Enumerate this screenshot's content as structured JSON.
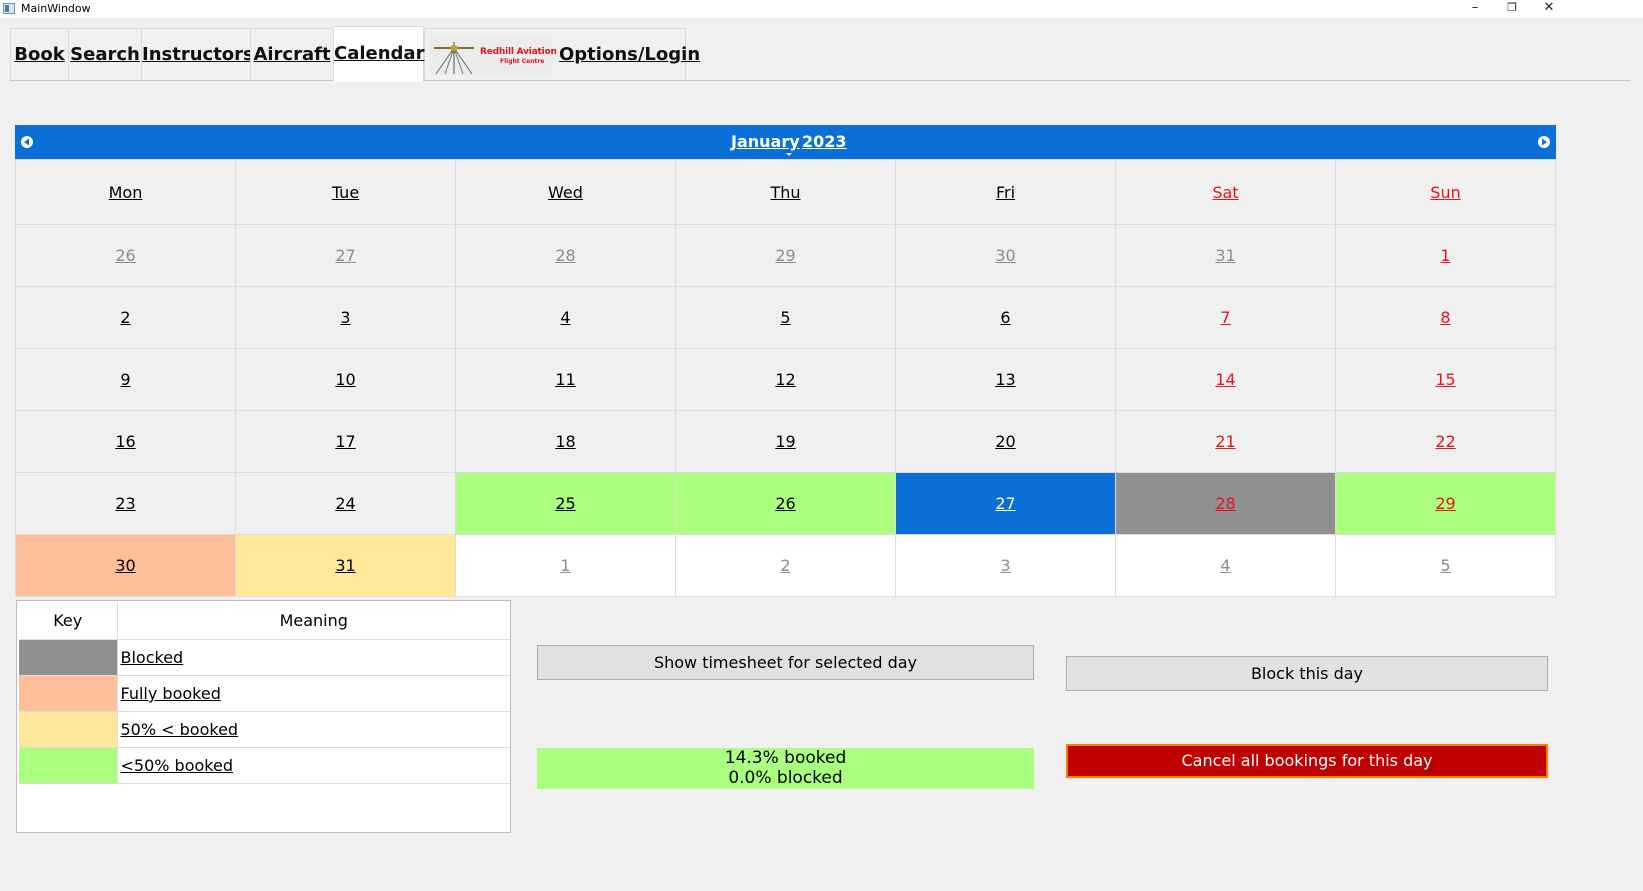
{
  "window": {
    "title": "MainWindow",
    "minimize": "–",
    "restore": "❐",
    "close": "✕"
  },
  "tabs": [
    {
      "label": "Book"
    },
    {
      "label": "Search"
    },
    {
      "label": "Instructors"
    },
    {
      "label": "Aircraft"
    },
    {
      "label": "Calendar"
    },
    {
      "label": "Options/Login"
    }
  ],
  "active_tab": "Calendar",
  "logo": {
    "line1": "Redhill Aviation",
    "line2": "Flight Centre"
  },
  "calendar": {
    "month": "January",
    "year": "2023",
    "weekdays": [
      "Mon",
      "Tue",
      "Wed",
      "Thu",
      "Fri",
      "Sat",
      "Sun"
    ],
    "weeks": [
      [
        "26",
        "27",
        "28",
        "29",
        "30",
        "31",
        "1"
      ],
      [
        "2",
        "3",
        "4",
        "5",
        "6",
        "7",
        "8"
      ],
      [
        "9",
        "10",
        "11",
        "12",
        "13",
        "14",
        "15"
      ],
      [
        "16",
        "17",
        "18",
        "19",
        "20",
        "21",
        "22"
      ],
      [
        "23",
        "24",
        "25",
        "26",
        "27",
        "28",
        "29"
      ],
      [
        "30",
        "31",
        "1",
        "2",
        "3",
        "4",
        "5"
      ]
    ],
    "selected_day": "27",
    "colors": {
      "header": "#0a6fd6",
      "blocked": "#909090",
      "fully_booked": "#ffbe9a",
      "over_half": "#ffe89a",
      "under_half": "#aaff7f",
      "weekend": "#e5141e"
    }
  },
  "key": {
    "headers": [
      "Key",
      "Meaning"
    ],
    "rows": [
      {
        "color": "#909090",
        "meaning": "Blocked"
      },
      {
        "color": "#ffbe9a",
        "meaning": "Fully booked"
      },
      {
        "color": "#ffe89a",
        "meaning": "50% < booked"
      },
      {
        "color": "#aaff7f",
        "meaning": "<50% booked"
      }
    ]
  },
  "buttons": {
    "show_timesheet": "Show timesheet for selected day",
    "block_day": "Block this day",
    "cancel_all": "Cancel all bookings for this day"
  },
  "stats": {
    "booked": "14.3% booked",
    "blocked": "0.0% blocked"
  }
}
